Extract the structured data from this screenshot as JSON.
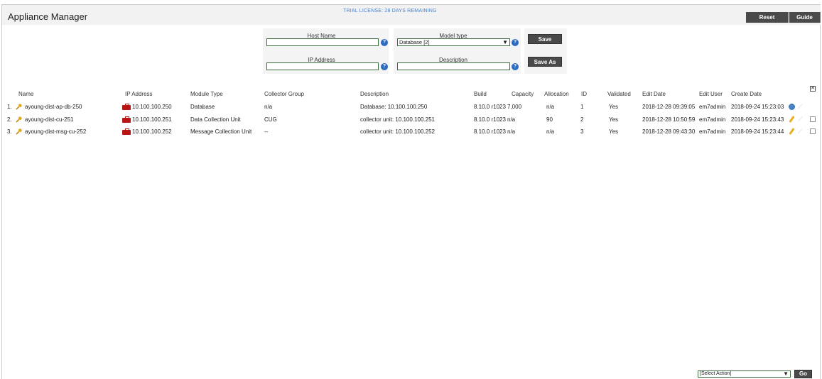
{
  "app": {
    "title": "Appliance Manager",
    "license_banner": "TRIAL LICENSE: 28 DAYS REMAINING",
    "reset_label": "Reset",
    "guide_label": "Guide"
  },
  "form": {
    "host_name_label": "Host Name",
    "host_name_value": "",
    "ip_address_label": "IP Address",
    "ip_address_value": "",
    "model_type_label": "Model type",
    "model_type_value": "Database [2]",
    "description_label": "Description",
    "description_value": "",
    "save_label": "Save",
    "save_as_label": "Save As",
    "help_glyph": "?"
  },
  "table": {
    "headers": {
      "name": "Name",
      "ip": "IP Address",
      "module_type": "Module Type",
      "collector_group": "Collector Group",
      "description": "Description",
      "build": "Build",
      "capacity": "Capacity",
      "allocation": "Allocation",
      "id": "ID",
      "validated": "Validated",
      "edit_date": "Edit Date",
      "edit_user": "Edit User",
      "create_date": "Create Date"
    },
    "rows": [
      {
        "num": "1.",
        "name": "ayoung-dist-ap-db-250",
        "ip": "10.100.100.250",
        "module_type": "Database",
        "collector_group": "n/a",
        "description": "Database: 10.100.100.250",
        "build": "8.10.0 r1023",
        "capacity": "7,000",
        "allocation": "n/a",
        "id": "1",
        "validated": "Yes",
        "edit_date": "2018-12-28 09:39:05",
        "edit_user": "em7admin",
        "create_date": "2018-09-24 15:23:03",
        "action_icon": "gear-icon"
      },
      {
        "num": "2.",
        "name": "ayoung-dist-cu-251",
        "ip": "10.100.100.251",
        "module_type": "Data Collection Unit",
        "collector_group": "CUG",
        "description": "collector unit: 10.100.100.251",
        "build": "8.10.0 r1023",
        "capacity": "n/a",
        "allocation": "90",
        "id": "2",
        "validated": "Yes",
        "edit_date": "2018-12-28 10:50:59",
        "edit_user": "em7admin",
        "create_date": "2018-09-24 15:23:43",
        "action_icon": "pencil-icon"
      },
      {
        "num": "3.",
        "name": "ayoung-dist-msg-cu-252",
        "ip": "10.100.100.252",
        "module_type": "Message Collection Unit",
        "collector_group": "--",
        "description": "collector unit: 10.100.100.252",
        "build": "8.10.0 r1023",
        "capacity": "n/a",
        "allocation": "n/a",
        "id": "3",
        "validated": "Yes",
        "edit_date": "2018-12-28 09:43:30",
        "edit_user": "em7admin",
        "create_date": "2018-09-24 15:23:44",
        "action_icon": "pencil-icon"
      }
    ]
  },
  "footer": {
    "action_select_value": "[Select Action]",
    "go_label": "Go"
  }
}
